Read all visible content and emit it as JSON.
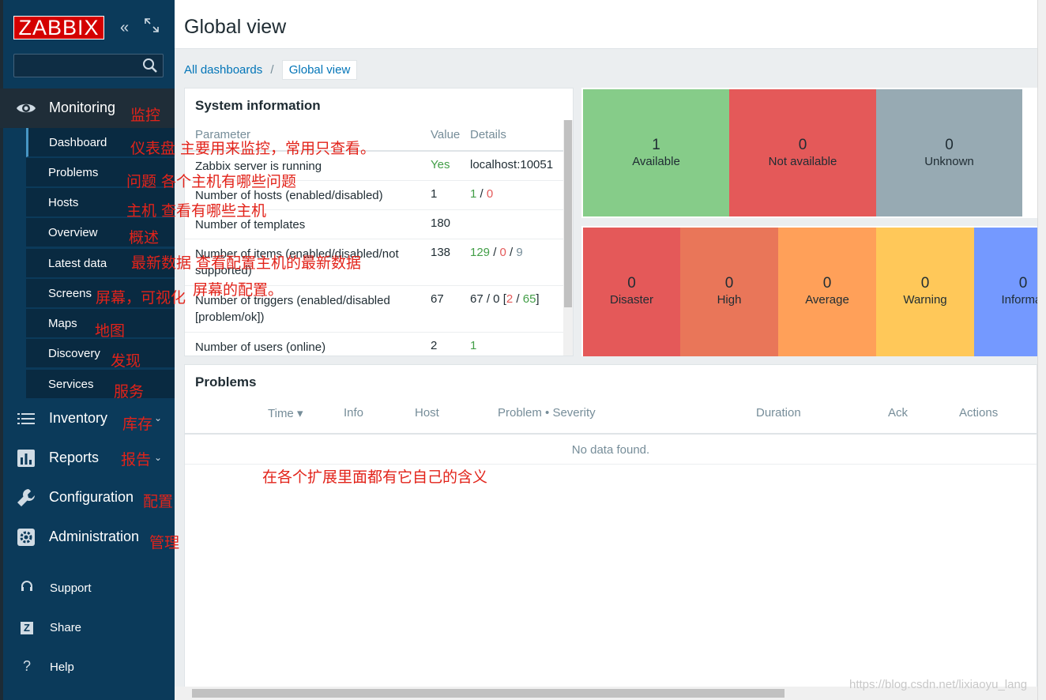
{
  "app": {
    "logo_text": "ZABBIX",
    "search_placeholder": ""
  },
  "sidebar": {
    "monitoring": {
      "label": "Monitoring",
      "icon": "eye-icon"
    },
    "submenu": [
      {
        "label": "Dashboard",
        "active": true
      },
      {
        "label": "Problems"
      },
      {
        "label": "Hosts"
      },
      {
        "label": "Overview"
      },
      {
        "label": "Latest data"
      },
      {
        "label": "Screens"
      },
      {
        "label": "Maps"
      },
      {
        "label": "Discovery"
      },
      {
        "label": "Services"
      }
    ],
    "main_items": [
      {
        "label": "Inventory",
        "icon": "list-icon"
      },
      {
        "label": "Reports",
        "icon": "bar-chart-icon"
      },
      {
        "label": "Configuration",
        "icon": "wrench-icon"
      },
      {
        "label": "Administration",
        "icon": "gear-icon"
      }
    ],
    "footer_items": [
      {
        "label": "Support",
        "icon": "headset-icon",
        "glyph": "🎧"
      },
      {
        "label": "Share",
        "icon": "share-z-icon",
        "glyph": "Z"
      },
      {
        "label": "Help",
        "icon": "help-icon",
        "glyph": "?"
      }
    ]
  },
  "annotations": {
    "monitoring": "监控",
    "dashboard": "仪表盘  主要用来监控，常用只查看。",
    "problems": "问题  各个主机有哪些问题",
    "hosts": "主机  查看有哪些主机",
    "overview": "概述",
    "latest_data": "最新数据  查看配置主机的最新数据",
    "screens": "屏幕，可视化",
    "screens_2": "屏幕的配置。",
    "maps": "地图",
    "discovery": "发现",
    "services": "服务",
    "inventory": "库存",
    "reports": "报告",
    "configuration": "配置",
    "administration": "管理",
    "problems_note": "在各个扩展里面都有它自己的含义"
  },
  "page": {
    "title": "Global view",
    "breadcrumb": {
      "root": "All dashboards",
      "separator": "/",
      "current": "Global view"
    }
  },
  "system_info": {
    "title": "System information",
    "columns": [
      "Parameter",
      "Value",
      "Details"
    ],
    "rows": [
      {
        "param": "Zabbix server is running",
        "value": "Yes",
        "details": "localhost:10051"
      },
      {
        "param": "Number of hosts (enabled/disabled)",
        "value": "1",
        "d1": "1",
        "d2": "0"
      },
      {
        "param": "Number of templates",
        "value": "180"
      },
      {
        "param": "Number of items (enabled/disabled/not supported)",
        "value": "138",
        "d1": "129",
        "d2": "0",
        "d3": "9"
      },
      {
        "param": "Number of triggers (enabled/disabled [problem/ok])",
        "value": "67",
        "d_prefix": "67 / 0 [",
        "d1": "2",
        "d2": "65",
        "d_suffix": "]"
      },
      {
        "param": "Number of users (online)",
        "value": "2",
        "d1": "1"
      }
    ]
  },
  "host_availability": [
    {
      "count": "1",
      "label": "Available",
      "color": "#86cc89"
    },
    {
      "count": "0",
      "label": "Not available",
      "color": "#e45959"
    },
    {
      "count": "0",
      "label": "Unknown",
      "color": "#97aab3"
    }
  ],
  "problems_by_severity": [
    {
      "count": "0",
      "label": "Disaster",
      "color": "#e45959"
    },
    {
      "count": "0",
      "label": "High",
      "color": "#e97659"
    },
    {
      "count": "0",
      "label": "Average",
      "color": "#ffa059"
    },
    {
      "count": "0",
      "label": "Warning",
      "color": "#ffc859"
    },
    {
      "count": "0",
      "label": "Informat",
      "color": "#7499ff"
    }
  ],
  "problems": {
    "title": "Problems",
    "columns": [
      "Time ▾",
      "Info",
      "Host",
      "Problem • Severity",
      "Duration",
      "Ack",
      "Actions"
    ],
    "empty": "No data found."
  },
  "watermark": "https://blog.csdn.net/lixiaoyu_lang"
}
